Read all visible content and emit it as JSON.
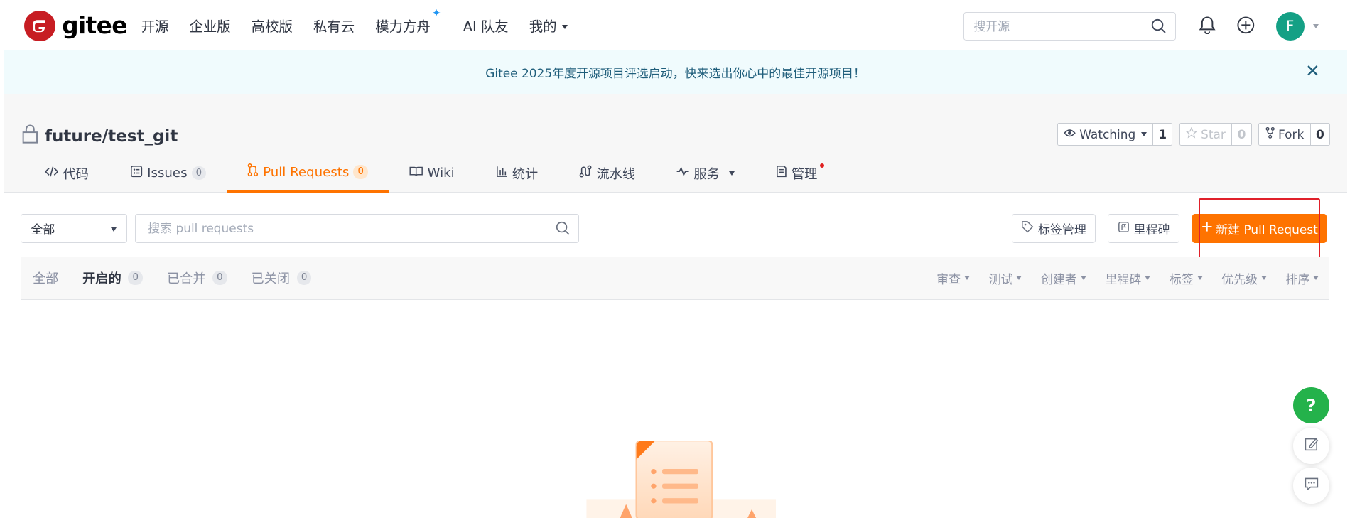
{
  "topnav": {
    "logo_text": "gitee",
    "items": [
      {
        "label": "开源"
      },
      {
        "label": "企业版"
      },
      {
        "label": "高校版"
      },
      {
        "label": "私有云"
      },
      {
        "label": "模力方舟"
      },
      {
        "label": "AI 队友"
      },
      {
        "label": "我的"
      }
    ],
    "search_placeholder": "搜开源",
    "avatar_letter": "F"
  },
  "banner": {
    "text": "Gitee 2025年度开源项目评选启动，快来选出你心中的最佳开源项目！",
    "close": "✕"
  },
  "repo": {
    "title": "future/test_git",
    "watch_label": "Watching",
    "watch_count": "1",
    "star_label": "Star",
    "star_count": "0",
    "fork_label": "Fork",
    "fork_count": "0"
  },
  "tabs": [
    {
      "label": "代码"
    },
    {
      "label": "Issues",
      "badge": "0"
    },
    {
      "label": "Pull Requests",
      "badge": "0"
    },
    {
      "label": "Wiki"
    },
    {
      "label": "统计"
    },
    {
      "label": "流水线"
    },
    {
      "label": "服务"
    },
    {
      "label": "管理"
    }
  ],
  "filter": {
    "select_value": "全部",
    "search_placeholder": "搜索 pull requests",
    "tag_manage": "标签管理",
    "milestone": "里程碑",
    "new_pr": "新建 Pull Request"
  },
  "states": [
    {
      "label": "全部"
    },
    {
      "label": "开启的",
      "count": "0"
    },
    {
      "label": "已合并",
      "count": "0"
    },
    {
      "label": "已关闭",
      "count": "0"
    }
  ],
  "sorts": [
    "审查",
    "测试",
    "创建者",
    "里程碑",
    "标签",
    "优先级",
    "排序"
  ],
  "float": {
    "help": "?"
  },
  "colors": {
    "accent": "#fe7300",
    "brand": "#c71d23",
    "help": "#24b24b"
  }
}
